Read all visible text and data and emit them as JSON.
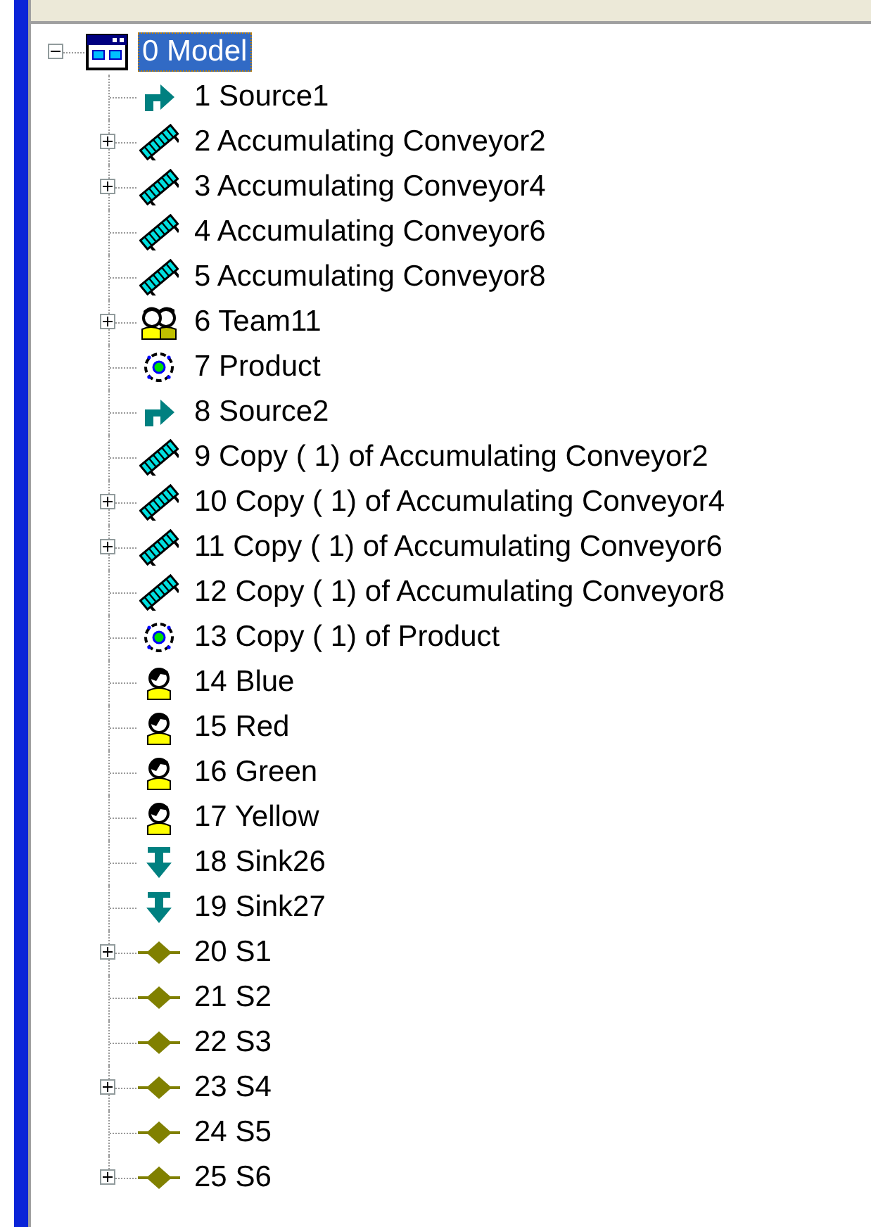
{
  "tree": {
    "label": "0 Model",
    "kind": "model",
    "expandable": true,
    "expanded": true,
    "selected": true,
    "children": [
      {
        "label": "1 Source1",
        "kind": "source",
        "expandable": false,
        "expanded": false,
        "selected": false
      },
      {
        "label": "2 Accumulating Conveyor2",
        "kind": "conveyor",
        "expandable": true,
        "expanded": false,
        "selected": false
      },
      {
        "label": "3 Accumulating Conveyor4",
        "kind": "conveyor",
        "expandable": true,
        "expanded": false,
        "selected": false
      },
      {
        "label": "4 Accumulating Conveyor6",
        "kind": "conveyor",
        "expandable": false,
        "expanded": false,
        "selected": false
      },
      {
        "label": "5 Accumulating Conveyor8",
        "kind": "conveyor",
        "expandable": false,
        "expanded": false,
        "selected": false
      },
      {
        "label": "6 Team11",
        "kind": "team",
        "expandable": true,
        "expanded": false,
        "selected": false
      },
      {
        "label": "7 Product",
        "kind": "product",
        "expandable": false,
        "expanded": false,
        "selected": false
      },
      {
        "label": "8 Source2",
        "kind": "source",
        "expandable": false,
        "expanded": false,
        "selected": false
      },
      {
        "label": "9 Copy ( 1) of Accumulating Conveyor2",
        "kind": "conveyor",
        "expandable": false,
        "expanded": false,
        "selected": false
      },
      {
        "label": "10 Copy ( 1) of Accumulating Conveyor4",
        "kind": "conveyor",
        "expandable": true,
        "expanded": false,
        "selected": false
      },
      {
        "label": "11 Copy ( 1) of Accumulating Conveyor6",
        "kind": "conveyor",
        "expandable": true,
        "expanded": false,
        "selected": false
      },
      {
        "label": "12 Copy ( 1) of Accumulating Conveyor8",
        "kind": "conveyor",
        "expandable": false,
        "expanded": false,
        "selected": false
      },
      {
        "label": "13 Copy ( 1) of Product",
        "kind": "product",
        "expandable": false,
        "expanded": false,
        "selected": false
      },
      {
        "label": "14 Blue",
        "kind": "resource",
        "expandable": false,
        "expanded": false,
        "selected": false
      },
      {
        "label": "15 Red",
        "kind": "resource",
        "expandable": false,
        "expanded": false,
        "selected": false
      },
      {
        "label": "16 Green",
        "kind": "resource",
        "expandable": false,
        "expanded": false,
        "selected": false
      },
      {
        "label": "17 Yellow",
        "kind": "resource",
        "expandable": false,
        "expanded": false,
        "selected": false
      },
      {
        "label": "18 Sink26",
        "kind": "sink",
        "expandable": false,
        "expanded": false,
        "selected": false
      },
      {
        "label": "19 Sink27",
        "kind": "sink",
        "expandable": false,
        "expanded": false,
        "selected": false
      },
      {
        "label": "20 S1",
        "kind": "node",
        "expandable": true,
        "expanded": false,
        "selected": false
      },
      {
        "label": "21 S2",
        "kind": "node",
        "expandable": false,
        "expanded": false,
        "selected": false
      },
      {
        "label": "22 S3",
        "kind": "node",
        "expandable": false,
        "expanded": false,
        "selected": false
      },
      {
        "label": "23 S4",
        "kind": "node",
        "expandable": true,
        "expanded": false,
        "selected": false
      },
      {
        "label": "24 S5",
        "kind": "node",
        "expandable": false,
        "expanded": false,
        "selected": false
      },
      {
        "label": "25 S6",
        "kind": "node",
        "expandable": true,
        "expanded": false,
        "selected": false
      }
    ]
  }
}
